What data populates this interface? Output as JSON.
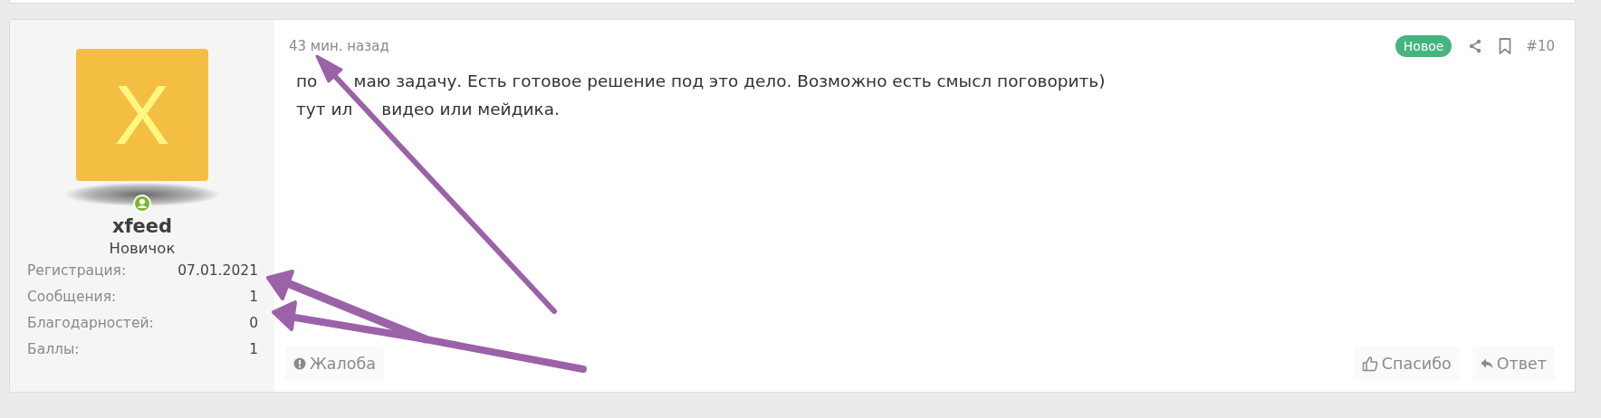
{
  "post": {
    "author": {
      "avatar_letter": "X",
      "online": true,
      "name": "xfeed",
      "rank": "Новичок",
      "stats": [
        {
          "label": "Регистрация:",
          "value": "07.01.2021"
        },
        {
          "label": "Сообщения:",
          "value": "1"
        },
        {
          "label": "Благодарностей:",
          "value": "0"
        },
        {
          "label": "Баллы:",
          "value": "1"
        }
      ]
    },
    "time": "43 мин. назад",
    "badge": "Новое",
    "number": "#10",
    "lines": [
      [
        "по",
        "маю задачу. Есть готовое решение под это дело. Возможно есть смысл поговорить)"
      ],
      [
        "тут ил",
        "видео или мейдика."
      ]
    ],
    "report_button": "Жалоба",
    "like_button": "Спасибо",
    "reply_button": "Ответ"
  }
}
